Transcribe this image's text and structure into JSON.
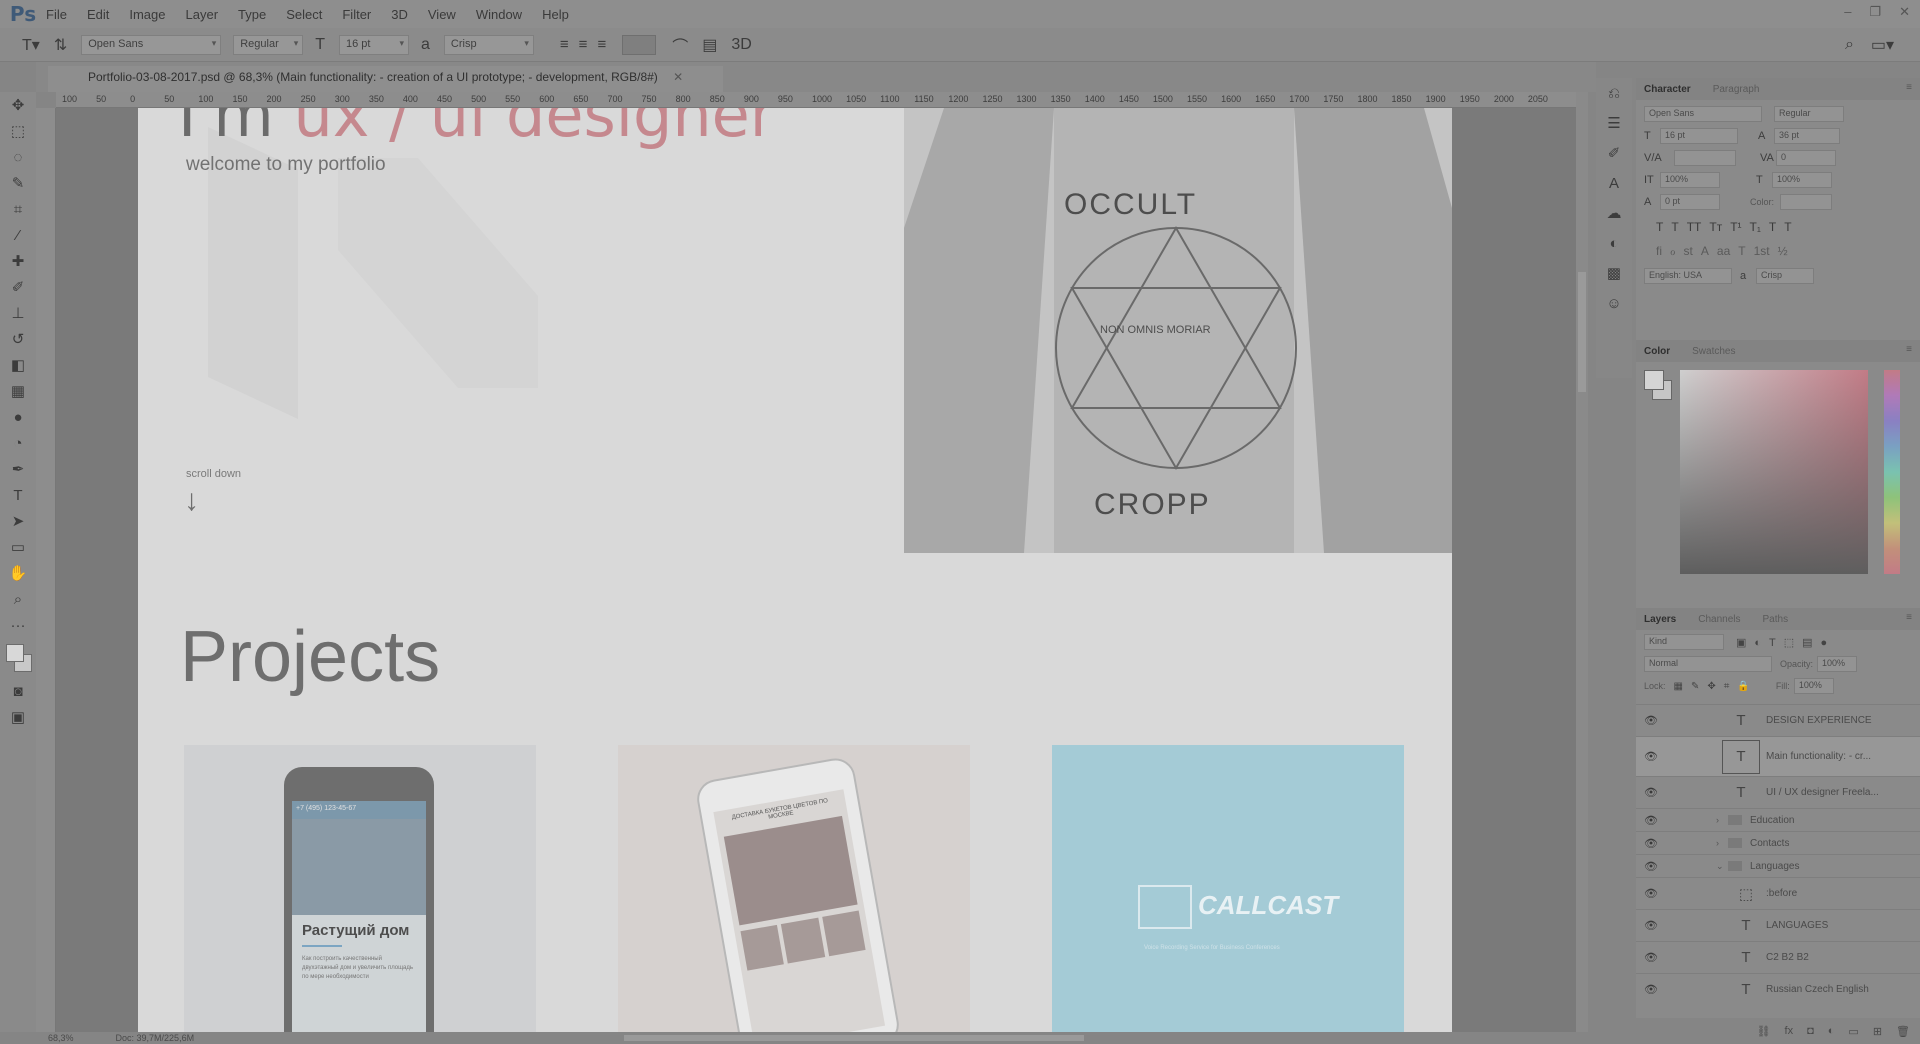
{
  "menubar": {
    "logo": "Ps",
    "items": [
      "File",
      "Edit",
      "Image",
      "Layer",
      "Type",
      "Select",
      "Filter",
      "3D",
      "View",
      "Window",
      "Help"
    ]
  },
  "options": {
    "font_family": "Open Sans",
    "font_style": "Regular",
    "font_size": "16 pt",
    "antialias": "Crisp",
    "threed_label": "3D"
  },
  "document": {
    "tab_title": "Portfolio-03-08-2017.psd @ 68,3% (Main functionality: - creation of a UI prototype; - development, RGB/8#)",
    "hero_title_plain": "I'm ",
    "hero_title_accent": "ux / ui designer",
    "hero_subtitle": "welcome to my portfolio",
    "scroll_label": "scroll down",
    "scroll_arrow": "↓",
    "photo_text_1": "OCCULT",
    "photo_text_2": "NON OMNIS MORIAR",
    "photo_text_3": "CROPP",
    "projects_heading": "Projects",
    "card1": {
      "bar_text": "+7 (495) 123-45-67",
      "heading": "Растущий дом",
      "body": "Как построить качественный двухэтажный дом и увеличить площадь по мере необходимости"
    },
    "card2": {
      "title": "ДОСТАВКА БУКЕТОВ ЦВЕТОВ ПО МОСКВЕ"
    },
    "card3": {
      "brand": "CALLCAST",
      "subtitle": "Voice Recording Service for Business Conferences"
    }
  },
  "rulers": {
    "h_ticks": [
      "100",
      "50",
      "0",
      "50",
      "100",
      "150",
      "200",
      "250",
      "300",
      "350",
      "400",
      "450",
      "500",
      "550",
      "600",
      "650",
      "700",
      "750",
      "800",
      "850",
      "900",
      "950",
      "1000",
      "1050",
      "1100",
      "1150",
      "1200",
      "1250",
      "1300",
      "1350",
      "1400",
      "1450",
      "1500",
      "1550",
      "1600",
      "1650",
      "1700",
      "1750",
      "1800",
      "1850",
      "1900",
      "1950",
      "2000",
      "2050"
    ]
  },
  "status": {
    "zoom": "68,3%",
    "doc_size": "Doc: 39,7M/225,6M"
  },
  "character": {
    "tabs": [
      "Character",
      "Paragraph"
    ],
    "font_family": "Open Sans",
    "font_style": "Regular",
    "size": "16 pt",
    "leading": "36 pt",
    "kerning_label": "V/A",
    "tracking": "0",
    "vscale": "100%",
    "hscale": "100%",
    "baseline": "0 pt",
    "color_label": "Color:",
    "language": "English: USA",
    "antialias": "Crisp",
    "glyphs1": [
      "T",
      "T",
      "TT",
      "Tᴛ",
      "T¹",
      "T₁",
      "T",
      "T"
    ],
    "glyphs2": [
      "fi",
      "ℴ",
      "st",
      "A",
      "aa",
      "T",
      "1st",
      "½"
    ]
  },
  "color_panel": {
    "tabs": [
      "Color",
      "Swatches"
    ]
  },
  "layers_panel": {
    "tabs": [
      "Layers",
      "Channels",
      "Paths"
    ],
    "filter": "Kind",
    "blend_mode": "Normal",
    "opacity_label": "Opacity:",
    "opacity": "100%",
    "lock_label": "Lock:",
    "fill_label": "Fill:",
    "fill": "100%",
    "layers": [
      {
        "type": "text",
        "name": "DESIGN EXPERIENCE",
        "selected": false
      },
      {
        "type": "text",
        "name": "Main functionality: - cr...",
        "selected": true
      },
      {
        "type": "text",
        "name": "UI / UX designer Freela...",
        "selected": false
      },
      {
        "type": "folder",
        "name": "Education",
        "expanded": false
      },
      {
        "type": "folder",
        "name": "Contacts",
        "expanded": false
      },
      {
        "type": "folder",
        "name": "Languages",
        "expanded": true
      },
      {
        "type": "shape",
        "name": ":before",
        "selected": false
      },
      {
        "type": "text",
        "name": "LANGUAGES",
        "selected": false
      },
      {
        "type": "text",
        "name": "C2 B2 B2",
        "selected": false
      },
      {
        "type": "text",
        "name": "Russian Czech English",
        "selected": false
      }
    ]
  }
}
